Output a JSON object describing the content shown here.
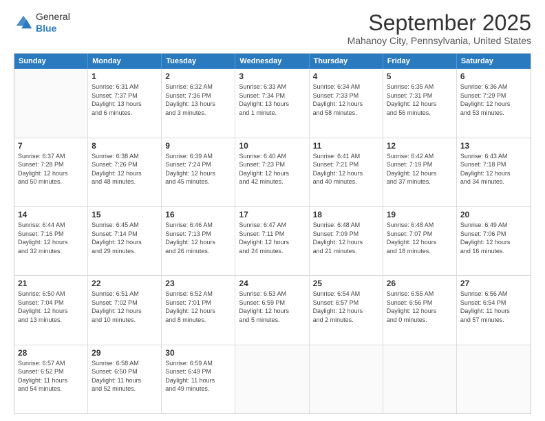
{
  "header": {
    "logo": {
      "general": "General",
      "blue": "Blue",
      "arrow_color": "#2a7abf"
    },
    "title": "September 2025",
    "subtitle": "Mahanoy City, Pennsylvania, United States"
  },
  "calendar": {
    "days_of_week": [
      "Sunday",
      "Monday",
      "Tuesday",
      "Wednesday",
      "Thursday",
      "Friday",
      "Saturday"
    ],
    "weeks": [
      [
        {
          "day": "",
          "empty": true
        },
        {
          "day": "1",
          "l1": "Sunrise: 6:31 AM",
          "l2": "Sunset: 7:37 PM",
          "l3": "Daylight: 13 hours",
          "l4": "and 6 minutes."
        },
        {
          "day": "2",
          "l1": "Sunrise: 6:32 AM",
          "l2": "Sunset: 7:36 PM",
          "l3": "Daylight: 13 hours",
          "l4": "and 3 minutes."
        },
        {
          "day": "3",
          "l1": "Sunrise: 6:33 AM",
          "l2": "Sunset: 7:34 PM",
          "l3": "Daylight: 13 hours",
          "l4": "and 1 minute."
        },
        {
          "day": "4",
          "l1": "Sunrise: 6:34 AM",
          "l2": "Sunset: 7:33 PM",
          "l3": "Daylight: 12 hours",
          "l4": "and 58 minutes."
        },
        {
          "day": "5",
          "l1": "Sunrise: 6:35 AM",
          "l2": "Sunset: 7:31 PM",
          "l3": "Daylight: 12 hours",
          "l4": "and 56 minutes."
        },
        {
          "day": "6",
          "l1": "Sunrise: 6:36 AM",
          "l2": "Sunset: 7:29 PM",
          "l3": "Daylight: 12 hours",
          "l4": "and 53 minutes."
        }
      ],
      [
        {
          "day": "7",
          "l1": "Sunrise: 6:37 AM",
          "l2": "Sunset: 7:28 PM",
          "l3": "Daylight: 12 hours",
          "l4": "and 50 minutes."
        },
        {
          "day": "8",
          "l1": "Sunrise: 6:38 AM",
          "l2": "Sunset: 7:26 PM",
          "l3": "Daylight: 12 hours",
          "l4": "and 48 minutes."
        },
        {
          "day": "9",
          "l1": "Sunrise: 6:39 AM",
          "l2": "Sunset: 7:24 PM",
          "l3": "Daylight: 12 hours",
          "l4": "and 45 minutes."
        },
        {
          "day": "10",
          "l1": "Sunrise: 6:40 AM",
          "l2": "Sunset: 7:23 PM",
          "l3": "Daylight: 12 hours",
          "l4": "and 42 minutes."
        },
        {
          "day": "11",
          "l1": "Sunrise: 6:41 AM",
          "l2": "Sunset: 7:21 PM",
          "l3": "Daylight: 12 hours",
          "l4": "and 40 minutes."
        },
        {
          "day": "12",
          "l1": "Sunrise: 6:42 AM",
          "l2": "Sunset: 7:19 PM",
          "l3": "Daylight: 12 hours",
          "l4": "and 37 minutes."
        },
        {
          "day": "13",
          "l1": "Sunrise: 6:43 AM",
          "l2": "Sunset: 7:18 PM",
          "l3": "Daylight: 12 hours",
          "l4": "and 34 minutes."
        }
      ],
      [
        {
          "day": "14",
          "l1": "Sunrise: 6:44 AM",
          "l2": "Sunset: 7:16 PM",
          "l3": "Daylight: 12 hours",
          "l4": "and 32 minutes."
        },
        {
          "day": "15",
          "l1": "Sunrise: 6:45 AM",
          "l2": "Sunset: 7:14 PM",
          "l3": "Daylight: 12 hours",
          "l4": "and 29 minutes."
        },
        {
          "day": "16",
          "l1": "Sunrise: 6:46 AM",
          "l2": "Sunset: 7:13 PM",
          "l3": "Daylight: 12 hours",
          "l4": "and 26 minutes."
        },
        {
          "day": "17",
          "l1": "Sunrise: 6:47 AM",
          "l2": "Sunset: 7:11 PM",
          "l3": "Daylight: 12 hours",
          "l4": "and 24 minutes."
        },
        {
          "day": "18",
          "l1": "Sunrise: 6:48 AM",
          "l2": "Sunset: 7:09 PM",
          "l3": "Daylight: 12 hours",
          "l4": "and 21 minutes."
        },
        {
          "day": "19",
          "l1": "Sunrise: 6:48 AM",
          "l2": "Sunset: 7:07 PM",
          "l3": "Daylight: 12 hours",
          "l4": "and 18 minutes."
        },
        {
          "day": "20",
          "l1": "Sunrise: 6:49 AM",
          "l2": "Sunset: 7:06 PM",
          "l3": "Daylight: 12 hours",
          "l4": "and 16 minutes."
        }
      ],
      [
        {
          "day": "21",
          "l1": "Sunrise: 6:50 AM",
          "l2": "Sunset: 7:04 PM",
          "l3": "Daylight: 12 hours",
          "l4": "and 13 minutes."
        },
        {
          "day": "22",
          "l1": "Sunrise: 6:51 AM",
          "l2": "Sunset: 7:02 PM",
          "l3": "Daylight: 12 hours",
          "l4": "and 10 minutes."
        },
        {
          "day": "23",
          "l1": "Sunrise: 6:52 AM",
          "l2": "Sunset: 7:01 PM",
          "l3": "Daylight: 12 hours",
          "l4": "and 8 minutes."
        },
        {
          "day": "24",
          "l1": "Sunrise: 6:53 AM",
          "l2": "Sunset: 6:59 PM",
          "l3": "Daylight: 12 hours",
          "l4": "and 5 minutes."
        },
        {
          "day": "25",
          "l1": "Sunrise: 6:54 AM",
          "l2": "Sunset: 6:57 PM",
          "l3": "Daylight: 12 hours",
          "l4": "and 2 minutes."
        },
        {
          "day": "26",
          "l1": "Sunrise: 6:55 AM",
          "l2": "Sunset: 6:56 PM",
          "l3": "Daylight: 12 hours",
          "l4": "and 0 minutes."
        },
        {
          "day": "27",
          "l1": "Sunrise: 6:56 AM",
          "l2": "Sunset: 6:54 PM",
          "l3": "Daylight: 11 hours",
          "l4": "and 57 minutes."
        }
      ],
      [
        {
          "day": "28",
          "l1": "Sunrise: 6:57 AM",
          "l2": "Sunset: 6:52 PM",
          "l3": "Daylight: 11 hours",
          "l4": "and 54 minutes."
        },
        {
          "day": "29",
          "l1": "Sunrise: 6:58 AM",
          "l2": "Sunset: 6:50 PM",
          "l3": "Daylight: 11 hours",
          "l4": "and 52 minutes."
        },
        {
          "day": "30",
          "l1": "Sunrise: 6:59 AM",
          "l2": "Sunset: 6:49 PM",
          "l3": "Daylight: 11 hours",
          "l4": "and 49 minutes."
        },
        {
          "day": "",
          "empty": true
        },
        {
          "day": "",
          "empty": true
        },
        {
          "day": "",
          "empty": true
        },
        {
          "day": "",
          "empty": true
        }
      ]
    ]
  }
}
